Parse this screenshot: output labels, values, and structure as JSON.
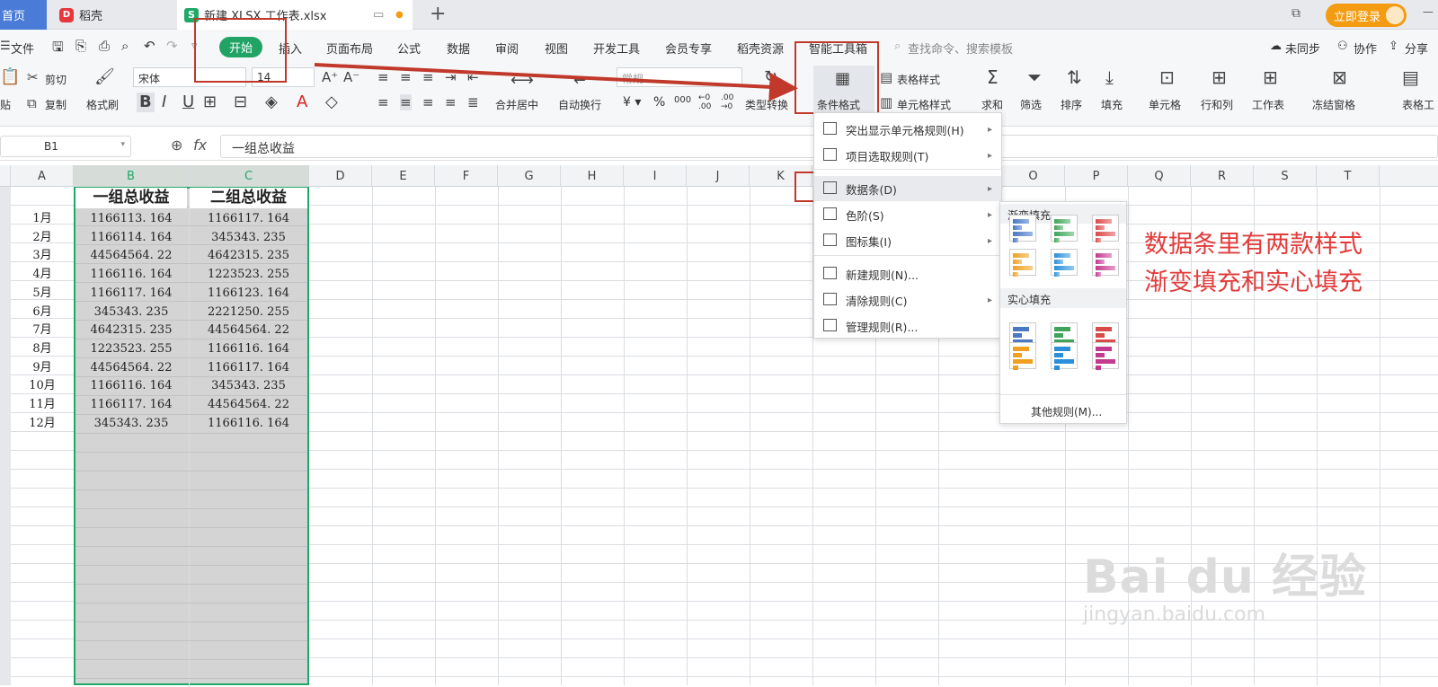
{
  "tabs": {
    "home": "首页",
    "daoke": "稻壳",
    "file": "新建 XLSX 工作表.xlsx",
    "login": "立即登录"
  },
  "menu": {
    "file": "文件",
    "start": "开始",
    "insert": "插入",
    "layout": "页面布局",
    "formula": "公式",
    "data": "数据",
    "review": "审阅",
    "view": "视图",
    "dev": "开发工具",
    "member": "会员专享",
    "daoke_res": "稻壳资源",
    "smart": "智能工具箱",
    "search": "查找命令、搜索模板",
    "sync": "未同步",
    "collab": "协作",
    "share": "分享"
  },
  "toolbar": {
    "cut": "剪切",
    "copy": "复制",
    "paste": "贴",
    "brush": "格式刷",
    "font": "宋体",
    "size": "14",
    "merge": "合并居中",
    "wrap": "自动换行",
    "numfmt": "常规",
    "typeconv": "类型转换",
    "cond": "条件格式",
    "tablestyle": "表格样式",
    "cellstyle": "单元格样式",
    "sum": "求和",
    "filter": "筛选",
    "sort": "排序",
    "fill": "填充",
    "cell": "单元格",
    "rowcol": "行和列",
    "sheet": "工作表",
    "freeze": "冻结窗格",
    "tabletool": "表格工"
  },
  "formula": {
    "cellref": "B1",
    "fx": "fx",
    "value": "一组总收益"
  },
  "columns": [
    "A",
    "B",
    "C",
    "D",
    "E",
    "F",
    "G",
    "H",
    "I",
    "J",
    "K",
    "O",
    "P",
    "Q",
    "R",
    "S",
    "T"
  ],
  "sheet": {
    "headerB": "一组总收益",
    "headerC": "二组总收益",
    "rows": [
      [
        "1月",
        "1166113. 164",
        "1166117. 164"
      ],
      [
        "2月",
        "1166114. 164",
        "345343. 235"
      ],
      [
        "3月",
        "44564564. 22",
        "4642315. 235"
      ],
      [
        "4月",
        "1166116. 164",
        "1223523. 255"
      ],
      [
        "5月",
        "1166117. 164",
        "1166123. 164"
      ],
      [
        "6月",
        "345343. 235",
        "2221250. 255"
      ],
      [
        "7月",
        "4642315. 235",
        "44564564. 22"
      ],
      [
        "8月",
        "1223523. 255",
        "1166116. 164"
      ],
      [
        "9月",
        "44564564. 22",
        "1166117. 164"
      ],
      [
        "10月",
        "1166116. 164",
        "345343. 235"
      ],
      [
        "11月",
        "1166117. 164",
        "44564564. 22"
      ],
      [
        "12月",
        "345343. 235",
        "1166116. 164"
      ]
    ]
  },
  "cfmenu": [
    "突出显示单元格规则(H)",
    "项目选取规则(T)",
    "数据条(D)",
    "色阶(S)",
    "图标集(I)",
    "新建规则(N)...",
    "清除规则(C)",
    "管理规则(R)..."
  ],
  "databar": {
    "gradient": "渐变填充",
    "solid": "实心填充",
    "other": "其他规则(M)..."
  },
  "annotation": {
    "line1": "数据条里有两款样式",
    "line2": "渐变填充和实心填充"
  },
  "watermark": {
    "main": "Bai du 经验",
    "sub": "jingyan.baidu.com"
  },
  "colors": {
    "accent": "#1fa969",
    "red": "#c0392b"
  }
}
